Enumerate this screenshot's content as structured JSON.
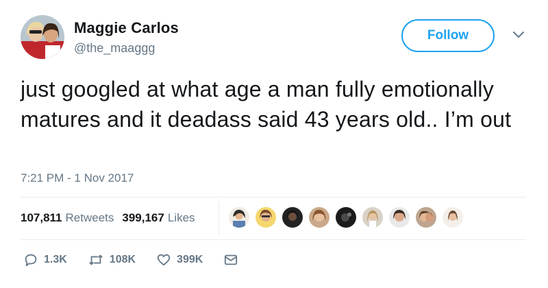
{
  "author": {
    "name": "Maggie Carlos",
    "handle": "@the_maaggg",
    "avatar_icon": "profile-photo-icon"
  },
  "follow_label": "Follow",
  "tweet": {
    "text": "just googled at what age a man fully emotionally matures and it deadass said 43 years old.. I’m out",
    "timestamp": "7:21 PM - 1 Nov 2017"
  },
  "stats": {
    "retweets_count": "107,811",
    "retweets_label": "Retweets",
    "likes_count": "399,167",
    "likes_label": "Likes"
  },
  "likers_icon": "liker-avatar-icon",
  "actions": {
    "reply_count": "1.3K",
    "retweet_count": "108K",
    "like_count": "399K"
  },
  "colors": {
    "accent": "#1da1f2",
    "secondary_text": "#657786",
    "divider": "#e6ecf0"
  }
}
